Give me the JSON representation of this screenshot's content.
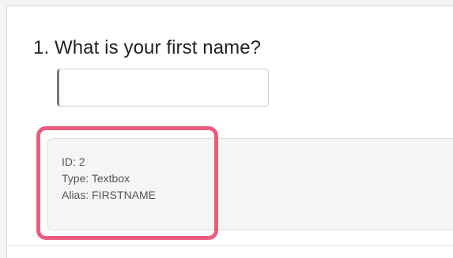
{
  "question": {
    "number_and_title": "1. What is your first name?",
    "input_value": "",
    "input_placeholder": ""
  },
  "meta": {
    "id_line": "ID: 2",
    "type_line": "Type: Textbox",
    "alias_line": "Alias: FIRSTNAME"
  },
  "colors": {
    "highlight": "#ea5d7f",
    "panel_background": "#f5f5f5",
    "page_background": "#ffffff"
  }
}
